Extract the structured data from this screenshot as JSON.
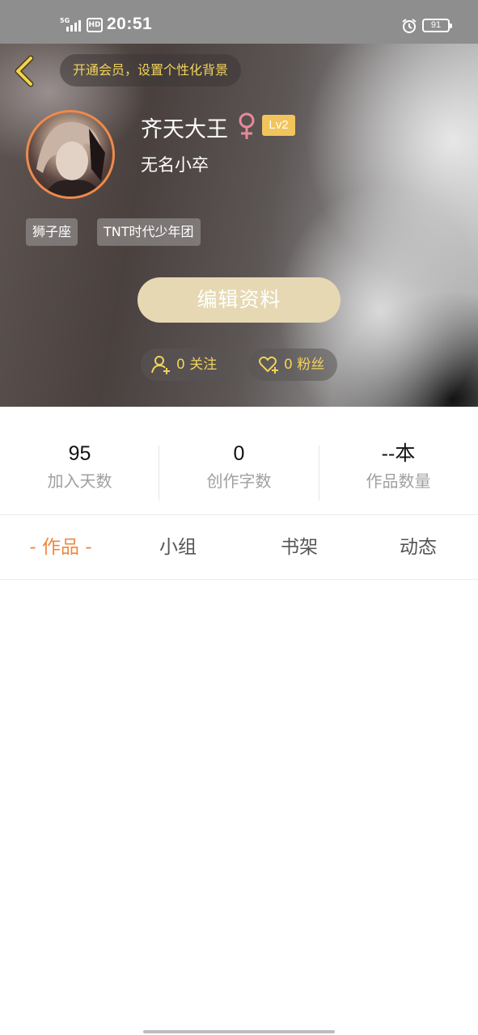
{
  "status_bar": {
    "network": "5G",
    "hd_label": "HD",
    "time": "20:51",
    "battery": "91"
  },
  "header": {
    "vip_prompt": "开通会员，设置个性化背景",
    "username": "齐天大王",
    "level": "Lv2",
    "title": "无名小卒",
    "tags": [
      "狮子座",
      "TNT时代少年团"
    ],
    "edit_button": "编辑资料",
    "following": "0 关注",
    "fans": "0 粉丝"
  },
  "stats": [
    {
      "value": "95",
      "label": "加入天数"
    },
    {
      "value": "0",
      "label": "创作字数"
    },
    {
      "value": "--本",
      "label": "作品数量"
    }
  ],
  "tabs": [
    {
      "label": "- 作品 -",
      "active": true
    },
    {
      "label": "小组",
      "active": false
    },
    {
      "label": "书架",
      "active": false
    },
    {
      "label": "动态",
      "active": false
    }
  ],
  "colors": {
    "accent": "#f0873d",
    "vip_text": "#f3d35a",
    "edit_button": "#e6d8b3",
    "level_badge": "#f2c45c",
    "gender_icon": "#e88a9a"
  },
  "icons": {
    "back": "chevron-left-icon",
    "gender": "female-icon",
    "following": "person-add-icon",
    "fans": "heart-add-icon",
    "alarm": "alarm-icon"
  }
}
